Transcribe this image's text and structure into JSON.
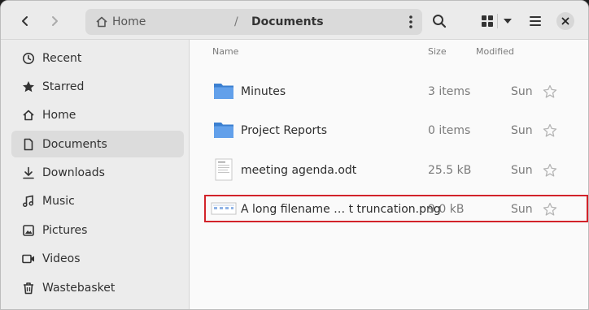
{
  "header": {
    "back_icon": "chevron-left-icon",
    "forward_icon": "chevron-right-icon",
    "path": {
      "home_label": "Home",
      "separator": "/",
      "current": "Documents"
    },
    "search_icon": "search-icon",
    "view_icon": "grid-view-icon",
    "menu_icon": "hamburger-icon",
    "close_icon": "close-icon"
  },
  "sidebar": {
    "items": [
      {
        "label": "Recent",
        "icon": "clock-icon"
      },
      {
        "label": "Starred",
        "icon": "star-icon"
      },
      {
        "label": "Home",
        "icon": "home-icon"
      },
      {
        "label": "Documents",
        "icon": "document-icon",
        "active": true
      },
      {
        "label": "Downloads",
        "icon": "download-icon"
      },
      {
        "label": "Music",
        "icon": "music-icon"
      },
      {
        "label": "Pictures",
        "icon": "picture-icon"
      },
      {
        "label": "Videos",
        "icon": "video-icon"
      },
      {
        "label": "Wastebasket",
        "icon": "trash-icon"
      }
    ]
  },
  "columns": {
    "name": "Name",
    "size": "Size",
    "modified": "Modified"
  },
  "files": [
    {
      "name": "Minutes",
      "size": "3 items",
      "modified": "Sun",
      "type": "folder"
    },
    {
      "name": "Project Reports",
      "size": "0 items",
      "modified": "Sun",
      "type": "folder"
    },
    {
      "name": "meeting agenda.odt",
      "size": "25.5 kB",
      "modified": "Sun",
      "type": "document"
    },
    {
      "name": "A long filename … t truncation.png",
      "size": "9.0 kB",
      "modified": "Sun",
      "type": "image"
    }
  ],
  "colors": {
    "highlight": "#d2232a",
    "folder": "#4a90d9",
    "sidebar_active": "#dcdcdc"
  }
}
